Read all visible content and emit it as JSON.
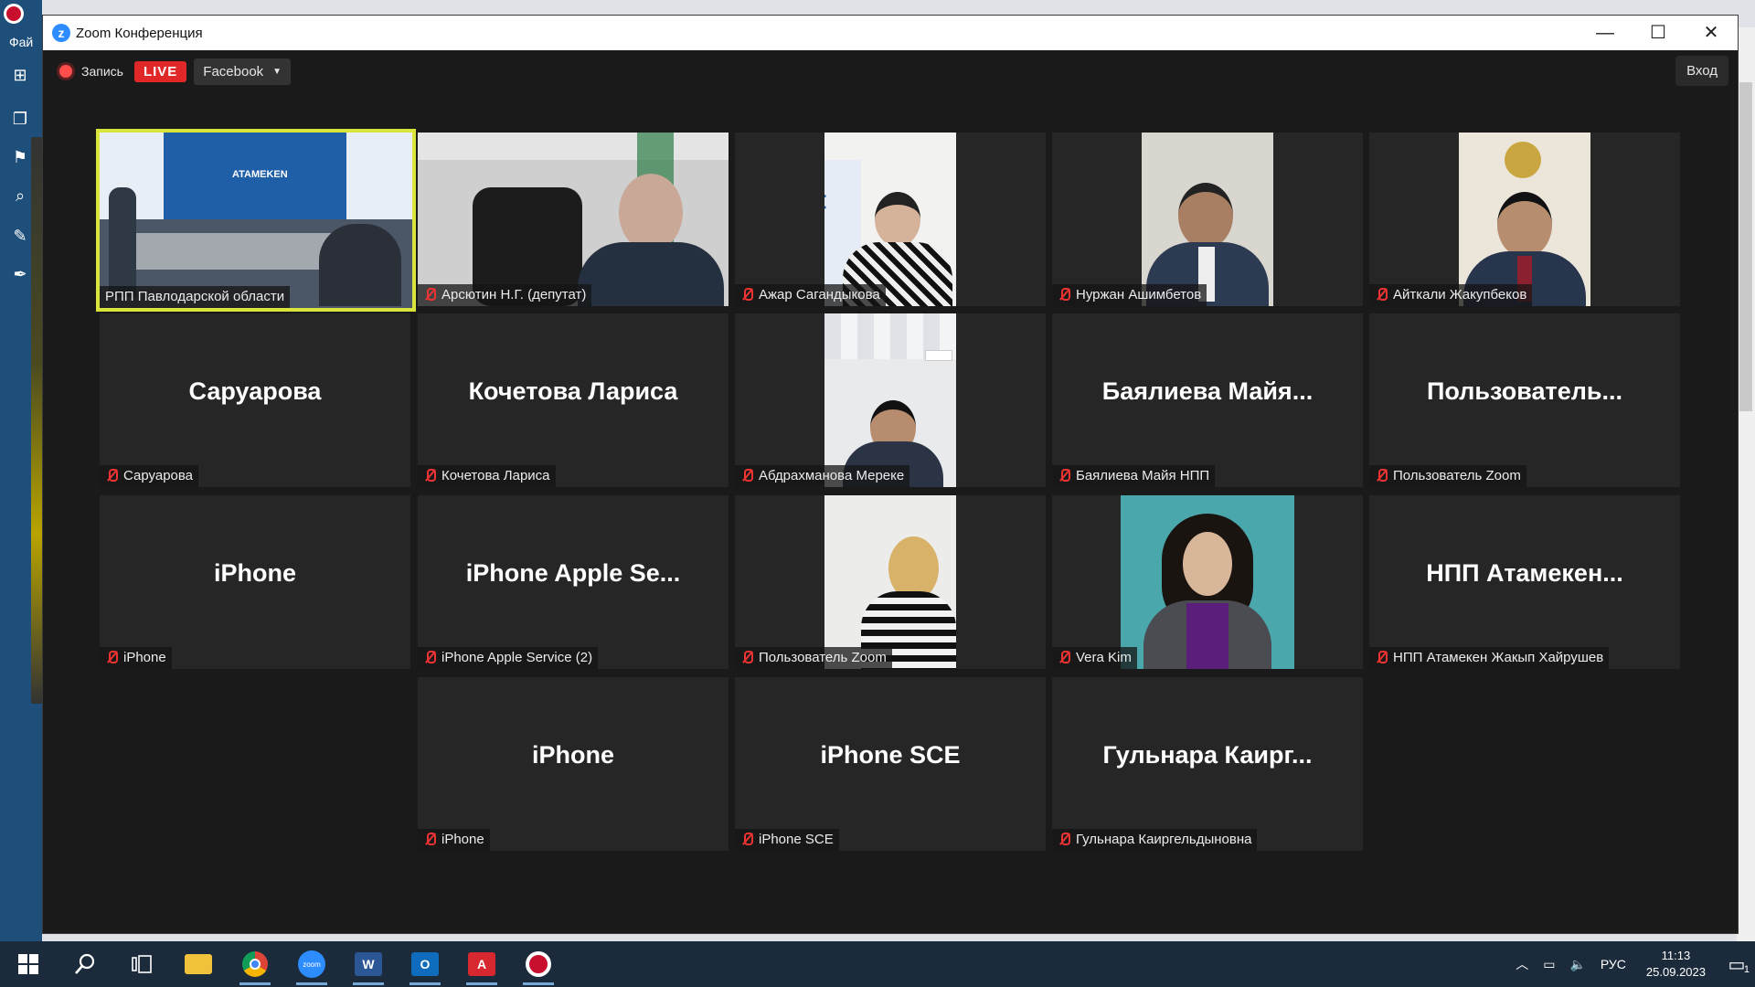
{
  "background_app": {
    "menu_label": "Фай"
  },
  "zoom_window": {
    "title": "Zoom Конференция",
    "controls": {
      "minimize": "—",
      "maximize": "☐",
      "close": "✕"
    }
  },
  "topbar": {
    "record_label": "Запись",
    "live_label": "LIVE",
    "stream_target": "Facebook",
    "signin_label": "Вход"
  },
  "participants": [
    {
      "display": "",
      "label": "РПП Павлодарской области",
      "video": true,
      "active": true,
      "muted": false
    },
    {
      "display": "",
      "label": "Арсютин Н.Г. (депутат)",
      "video": true,
      "muted": true
    },
    {
      "display": "",
      "label": "Ажар Сагандыкова",
      "video": true,
      "muted": true
    },
    {
      "display": "",
      "label": "Нуржан Ашимбетов",
      "video": true,
      "muted": true
    },
    {
      "display": "",
      "label": "Айткали Жакупбеков",
      "video": true,
      "muted": true
    },
    {
      "display": "Саруарова",
      "label": "Саруарова",
      "video": false,
      "muted": true
    },
    {
      "display": "Кочетова Лариса",
      "label": "Кочетова Лариса",
      "video": false,
      "muted": true
    },
    {
      "display": "",
      "label": "Абдрахманова Мереке",
      "video": true,
      "muted": true
    },
    {
      "display": "Баялиева  Майя...",
      "label": "Баялиева Майя НПП",
      "video": false,
      "muted": true
    },
    {
      "display": "Пользователь...",
      "label": "Пользователь Zoom",
      "video": false,
      "muted": true
    },
    {
      "display": "iPhone",
      "label": "iPhone",
      "video": false,
      "muted": true
    },
    {
      "display": "iPhone  Apple  Se...",
      "label": "iPhone Apple Service (2)",
      "video": false,
      "muted": true
    },
    {
      "display": "",
      "label": "Пользователь Zoom",
      "video": true,
      "muted": true
    },
    {
      "display": "",
      "label": "Vera Kim",
      "video": true,
      "muted": true
    },
    {
      "display": "НПП  Атамекен...",
      "label": "НПП Атамекен Жакып Хайрушев",
      "video": false,
      "muted": true
    },
    {
      "display": "iPhone",
      "label": "iPhone",
      "video": false,
      "muted": true
    },
    {
      "display": "iPhone SCE",
      "label": "iPhone SCE",
      "video": false,
      "muted": true
    },
    {
      "display": "Гульнара  Каирг...",
      "label": "Гульнара Каиргельдыновна",
      "video": false,
      "muted": true
    }
  ],
  "taskbar": {
    "language": "РУС",
    "time": "11:13",
    "date": "25.09.2023",
    "notifications": "1",
    "apps": [
      "start-icon",
      "search-icon",
      "task-view-icon",
      "file-explorer-icon",
      "chrome-icon",
      "zoom-icon",
      "word-icon",
      "outlook-icon",
      "acrobat-icon",
      "red-app-icon"
    ]
  },
  "colors": {
    "active_speaker_border": "#d9e53a",
    "live_red": "#e02828",
    "muted_red": "#e33333",
    "zoom_blue": "#2d8cff"
  }
}
